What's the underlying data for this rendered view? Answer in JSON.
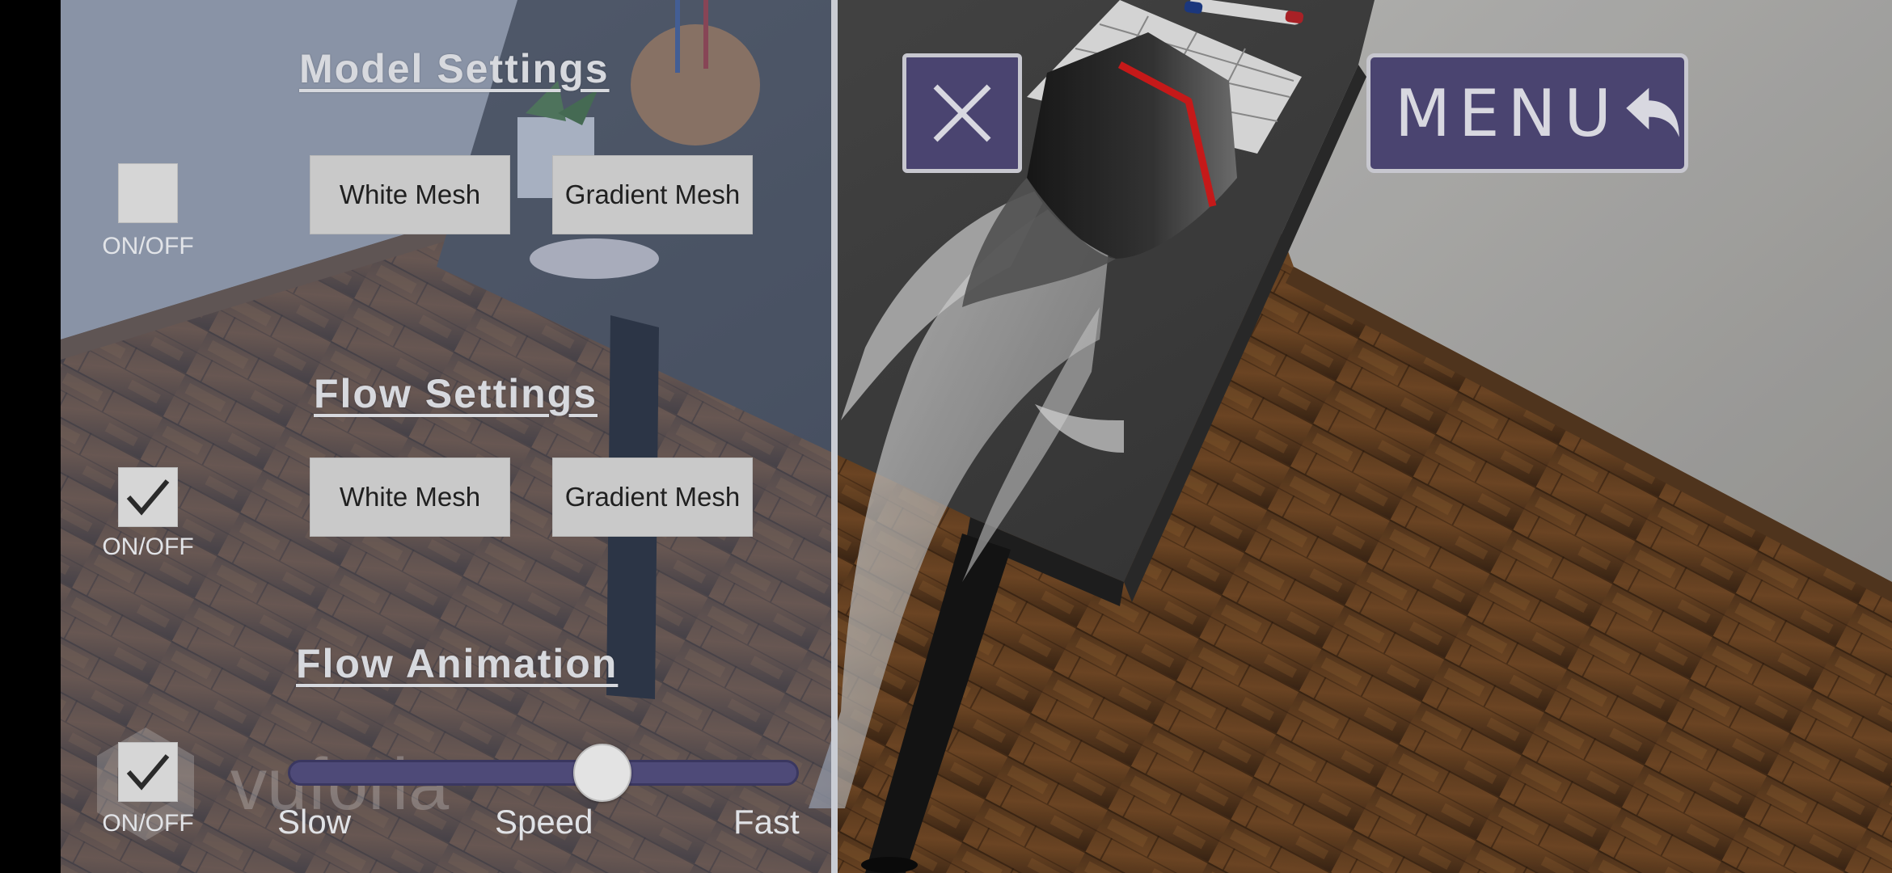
{
  "model_settings": {
    "title": "Model Settings",
    "toggle_checked": false,
    "toggle_label": "ON/OFF",
    "white_mesh_label": "White Mesh",
    "gradient_mesh_label": "Gradient Mesh"
  },
  "flow_settings": {
    "title": "Flow Settings",
    "toggle_checked": true,
    "toggle_label": "ON/OFF",
    "white_mesh_label": "White Mesh",
    "gradient_mesh_label": "Gradient Mesh"
  },
  "flow_animation": {
    "title": "Flow Animation",
    "toggle_checked": true,
    "toggle_label": "ON/OFF",
    "speed_value": 0.63,
    "slow_label": "Slow",
    "speed_label": "Speed",
    "fast_label": "Fast"
  },
  "toolbar": {
    "menu_label": "MENU",
    "close_icon": "close-icon",
    "menu_icon": "back-arrow-icon"
  },
  "watermark": {
    "text": "vuforia"
  },
  "colors": {
    "button_bg": "#4a4470",
    "slider_track": "#4e4a78",
    "panel_tint": "#4e648c",
    "mesh_button_bg": "#c9c9c9"
  }
}
